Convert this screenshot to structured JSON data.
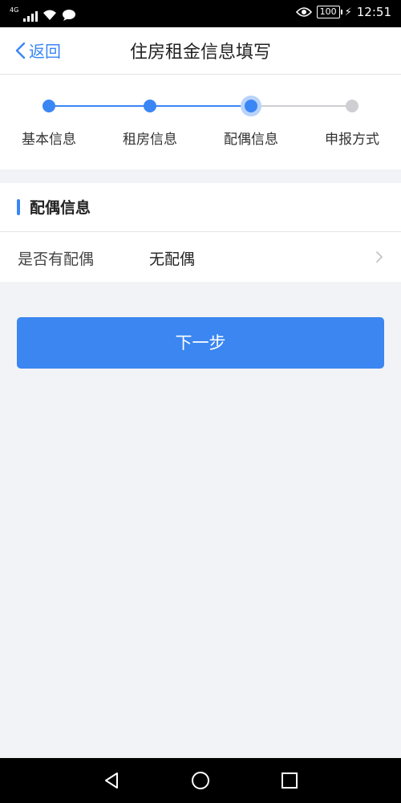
{
  "status_bar": {
    "network": "4G",
    "battery": "100",
    "time": "12:51",
    "icons": [
      "signal-icon",
      "wifi-icon",
      "chat-icon",
      "eye-icon",
      "battery-icon",
      "charging-icon"
    ]
  },
  "nav": {
    "back_label": "返回",
    "title": "住房租金信息填写"
  },
  "steps": [
    {
      "label": "基本信息",
      "state": "done"
    },
    {
      "label": "租房信息",
      "state": "done"
    },
    {
      "label": "配偶信息",
      "state": "current"
    },
    {
      "label": "申报方式",
      "state": "pending"
    }
  ],
  "section": {
    "title": "配偶信息",
    "rows": [
      {
        "label": "是否有配偶",
        "value": "无配偶"
      }
    ]
  },
  "next_button": "下一步",
  "colors": {
    "accent": "#3a86f4",
    "background": "#f2f3f7",
    "pending": "#cfcfd3"
  }
}
